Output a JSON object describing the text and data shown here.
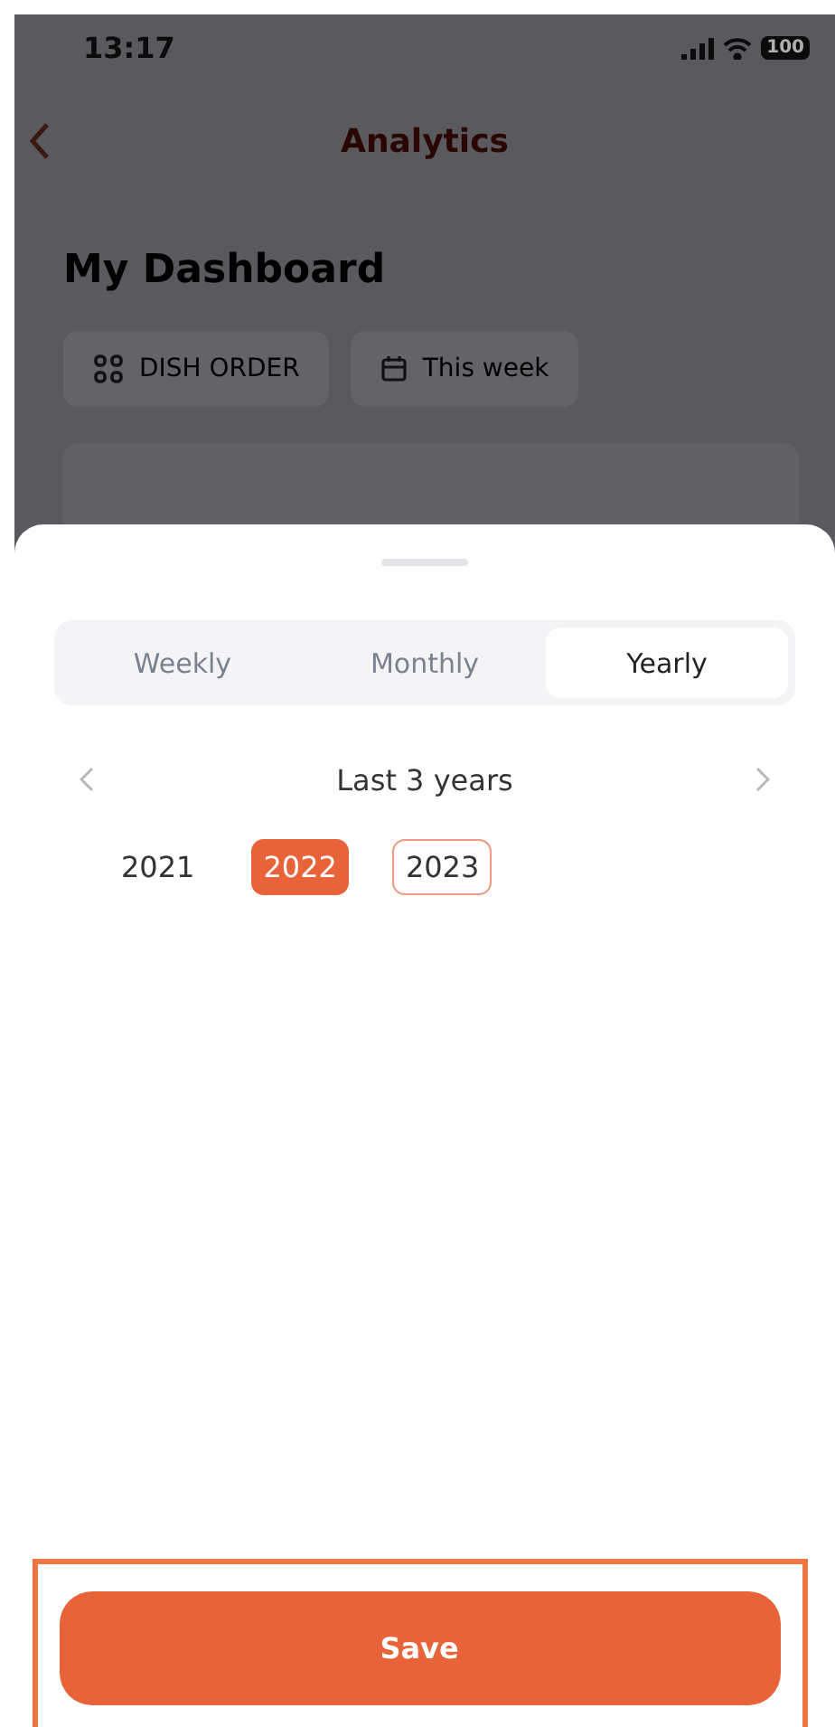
{
  "status_bar": {
    "time": "13:17",
    "battery": "100"
  },
  "header": {
    "title": "Analytics"
  },
  "dashboard": {
    "title": "My Dashboard",
    "chips": [
      {
        "kind": "grid",
        "label": "DISH ORDER"
      },
      {
        "kind": "calendar",
        "label": "This week"
      }
    ]
  },
  "sheet": {
    "tabs": [
      {
        "label": "Weekly",
        "selected": false
      },
      {
        "label": "Monthly",
        "selected": false
      },
      {
        "label": "Yearly",
        "selected": true
      }
    ],
    "range": "Last 3 years",
    "years": [
      {
        "label": "2021",
        "selected": false,
        "current": false
      },
      {
        "label": "2022",
        "selected": true,
        "current": false
      },
      {
        "label": "2023",
        "selected": false,
        "current": true
      }
    ],
    "save": "Save"
  }
}
